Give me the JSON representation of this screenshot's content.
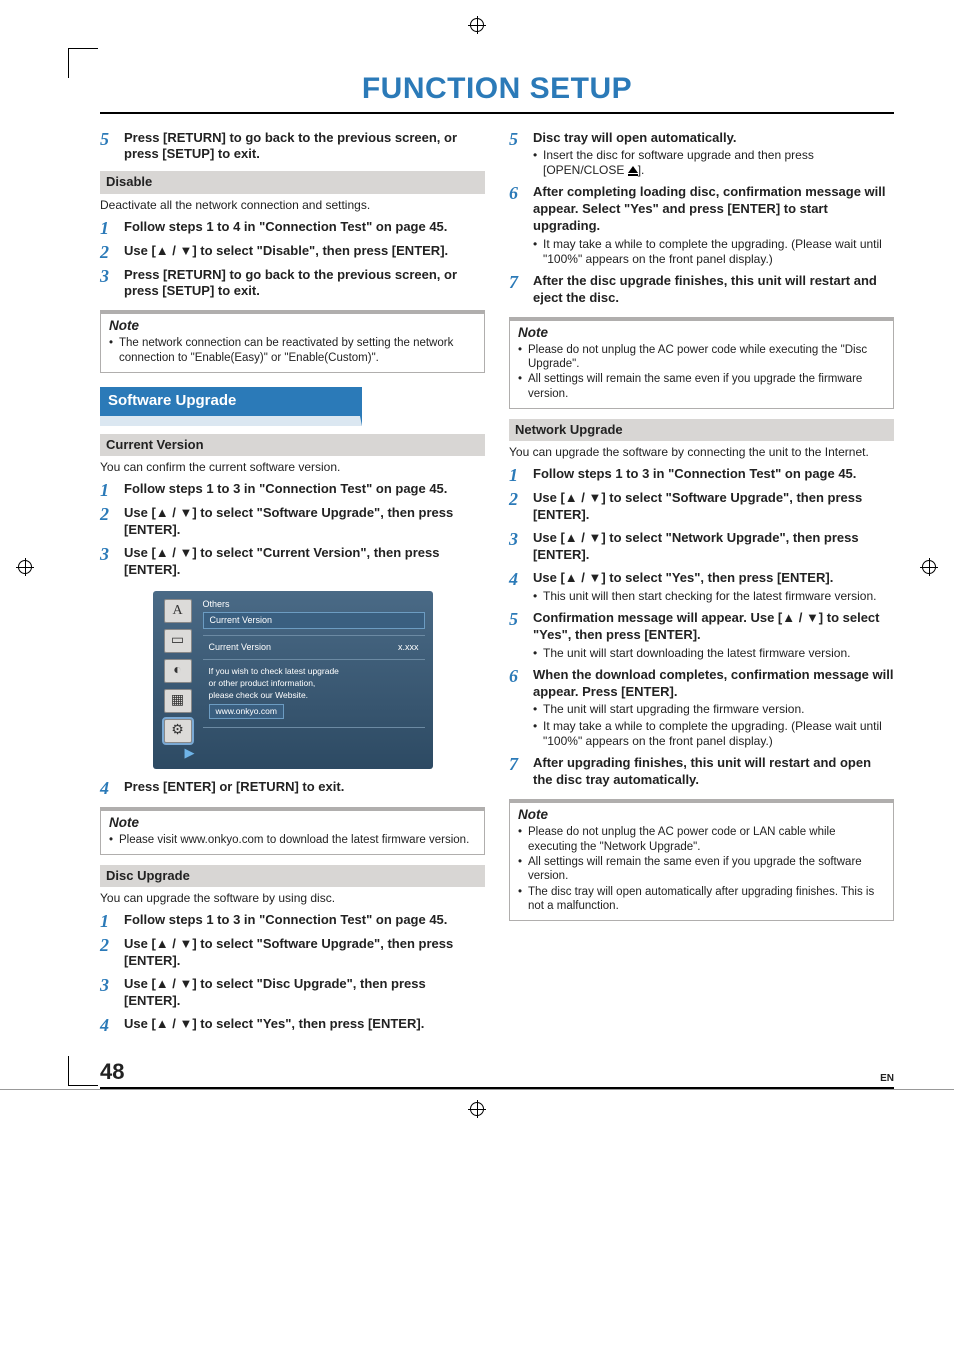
{
  "title": "FUNCTION SETUP",
  "left": {
    "step5": "Press [RETURN] to go back to the previous screen, or press [SETUP] to exit.",
    "disable_head": "Disable",
    "disable_intro": "Deactivate all the network connection and settings.",
    "d1": "Follow steps 1 to 4 in \"Connection Test\" on page 45.",
    "d2": "Use [▲ / ▼] to select \"Disable\", then press [ENTER].",
    "d3": "Press [RETURN] to go back to the previous screen, or press [SETUP] to exit.",
    "note1_title": "Note",
    "note1_a": "The network connection can be reactivated by setting the network connection to \"Enable(Easy)\" or \"Enable(Custom)\".",
    "sw_head": "Software Upgrade",
    "cv_head": "Current Version",
    "cv_intro": "You can confirm the current software version.",
    "cv1": "Follow steps 1 to 3 in \"Connection Test\" on page 45.",
    "cv2": "Use [▲ / ▼] to select \"Software Upgrade\", then press [ENTER].",
    "cv3": "Use [▲ / ▼] to select \"Current Version\", then press [ENTER].",
    "cv4": "Press [ENTER] or [RETURN] to exit.",
    "note2_title": "Note",
    "note2_a": "Please visit www.onkyo.com to download the latest firmware version.",
    "du_head": "Disc Upgrade",
    "du_intro": "You can upgrade the software by using disc.",
    "du1": "Follow steps 1 to 3 in \"Connection Test\" on page 45.",
    "du2": "Use [▲ / ▼] to select \"Software Upgrade\", then press [ENTER].",
    "du3": "Use [▲ / ▼] to select \"Disc Upgrade\", then press [ENTER].",
    "du4": "Use [▲ / ▼] to select \"Yes\", then press [ENTER]."
  },
  "right": {
    "r5": "Disc tray will open automatically.",
    "r5a": "Insert the disc for software upgrade and then press [OPEN/CLOSE ",
    "r5b": "].",
    "r6": "After completing loading disc, confirmation message will appear. Select \"Yes\" and press [ENTER] to start upgrading.",
    "r6a": "It may take a while to complete the upgrading. (Please wait until \"100%\" appears on the front panel display.)",
    "r7": "After the disc upgrade finishes, this unit will restart and eject the disc.",
    "rn_title": "Note",
    "rn_a": "Please do not unplug the AC power code while executing the \"Disc Upgrade\".",
    "rn_b": "All settings will remain the same even if you upgrade the firmware version.",
    "nu_head": "Network Upgrade",
    "nu_intro": "You can upgrade the software by connecting the unit to the Internet.",
    "nu1": "Follow steps 1 to 3 in \"Connection Test\" on page 45.",
    "nu2": "Use [▲ / ▼] to select \"Software Upgrade\", then press [ENTER].",
    "nu3": "Use [▲ / ▼] to select \"Network Upgrade\", then press [ENTER].",
    "nu4": "Use [▲ / ▼] to select \"Yes\", then press [ENTER].",
    "nu4a": "This unit will then start checking for the latest firmware version.",
    "nu5": "Confirmation message will appear. Use [▲ / ▼] to select \"Yes\", then press [ENTER].",
    "nu5a": "The unit will start downloading the latest firmware version.",
    "nu6": "When the download completes, confirmation message will appear. Press [ENTER].",
    "nu6a": "The unit will start upgrading the firmware version.",
    "nu6b": "It may take a while to complete the upgrading. (Please wait until \"100%\" appears on the front panel display.)",
    "nu7": "After upgrading finishes, this unit will restart and open the disc tray automatically.",
    "nn_title": "Note",
    "nn_a": "Please do not unplug the AC power code or LAN cable while executing the \"Network Upgrade\".",
    "nn_b": "All settings will remain the same even if you upgrade the software version.",
    "nn_c": "The disc tray will open automatically after upgrading finishes. This is not a malfunction."
  },
  "ui": {
    "crumb": "Others",
    "highlight": "Current Version",
    "row_l": "Current Version",
    "row_r": "x.xxx",
    "info1": "If you wish to check latest upgrade",
    "info2": "or other product information,",
    "info3": "please check our Website.",
    "url": "www.onkyo.com",
    "iconA": "A"
  },
  "footer": {
    "page": "48",
    "lang": "EN"
  }
}
